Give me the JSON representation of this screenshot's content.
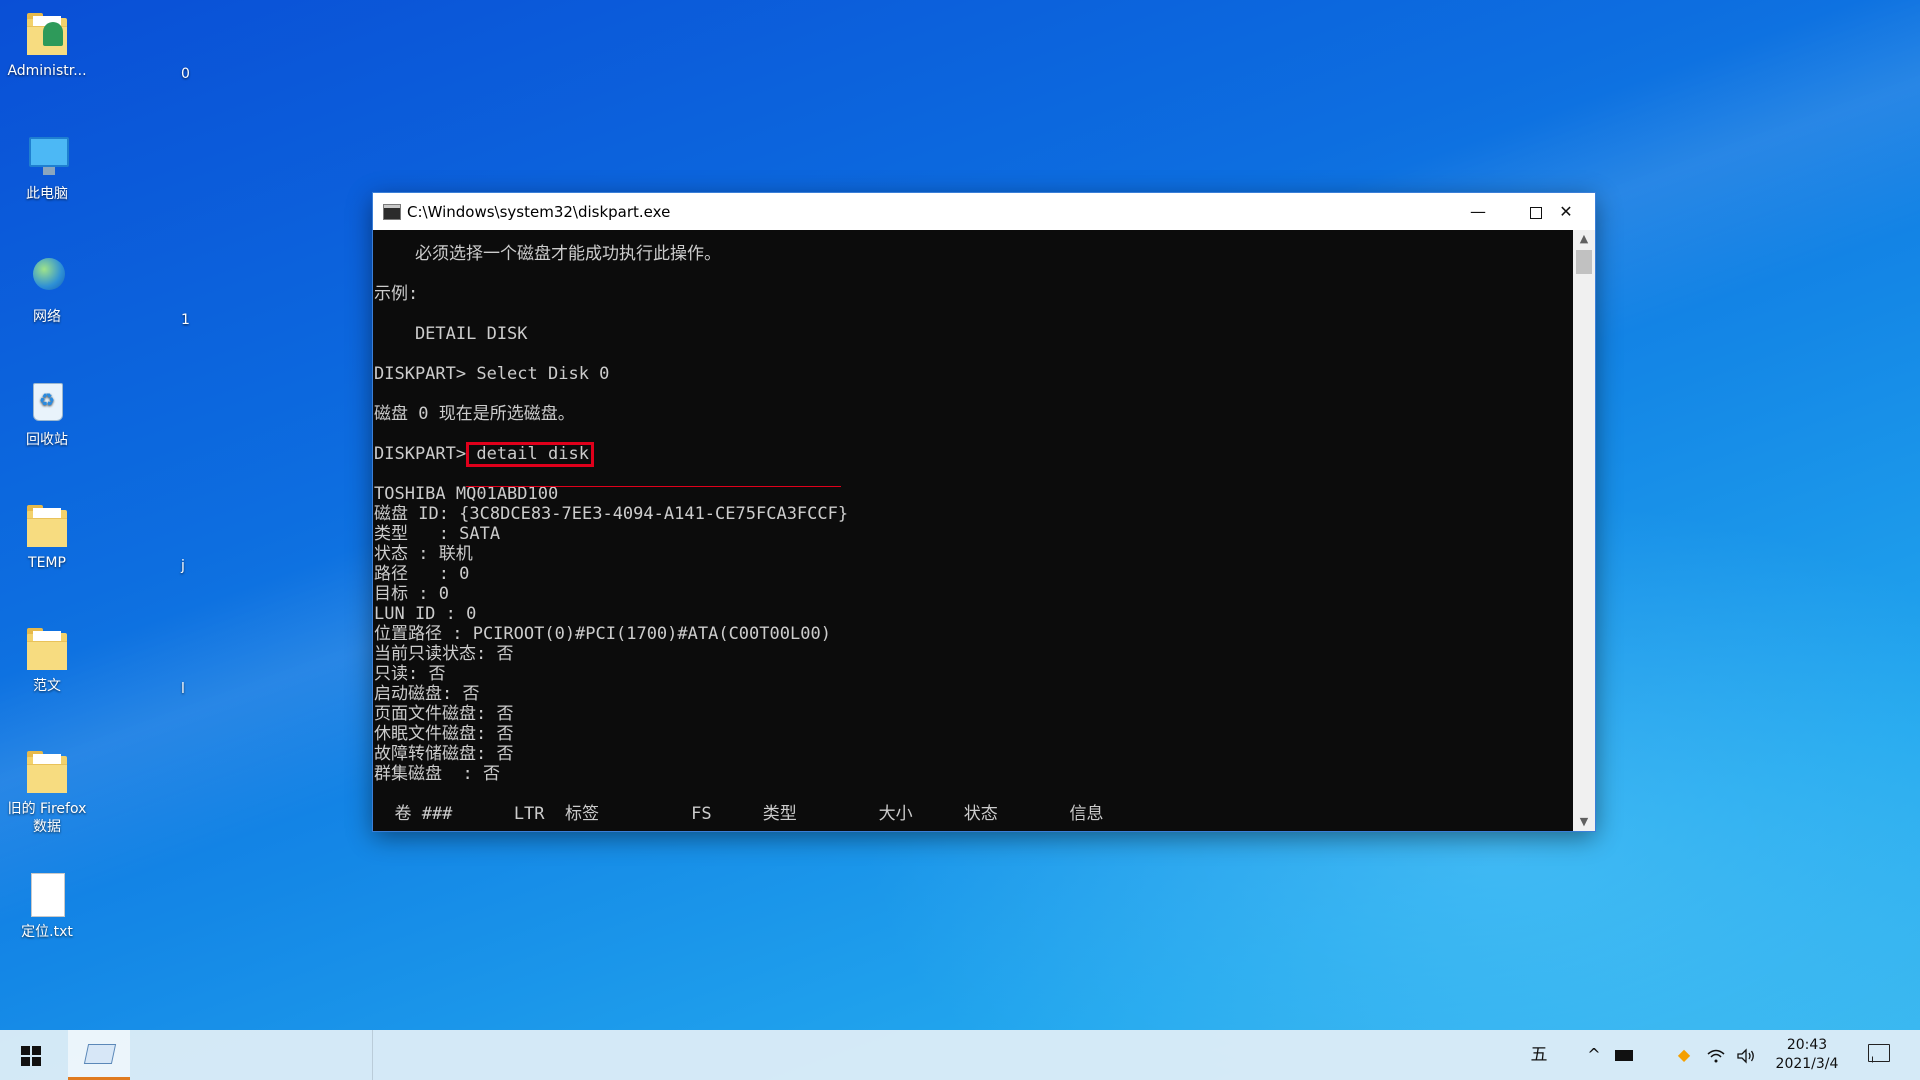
{
  "desktop": {
    "icons": [
      {
        "label": "Administr...",
        "icon": "user-folder-icon"
      },
      {
        "label": "此电脑",
        "icon": "computer-icon"
      },
      {
        "label": "网络",
        "icon": "network-icon"
      },
      {
        "label": "回收站",
        "icon": "recycle-bin-icon"
      },
      {
        "label": "TEMP",
        "icon": "folder-icon"
      },
      {
        "label": "范文",
        "icon": "folder-icon"
      },
      {
        "label": "旧的 Firefox\n数据",
        "icon": "folder-icon"
      },
      {
        "label": "定位.txt",
        "icon": "text-file-icon"
      }
    ],
    "partial_labels": [
      "0",
      "1",
      "l",
      "j"
    ]
  },
  "window": {
    "title": "C:\\Windows\\system32\\diskpart.exe",
    "minimize": "—",
    "close": "✕"
  },
  "console": {
    "lines": [
      "    必须选择一个磁盘才能成功执行此操作。",
      "",
      "示例:",
      "",
      "    DETAIL DISK",
      "",
      "DISKPART> Select Disk 0",
      "",
      "磁盘 0 现在是所选磁盘。",
      "",
      "DISKPART> detail disk",
      "",
      "TOSHIBA MQ01ABD100",
      "磁盘 ID: {3C8DCE83-7EE3-4094-A141-CE75FCA3FCCF}",
      "类型   : SATA",
      "状态 : 联机",
      "路径   : 0",
      "目标 : 0",
      "LUN ID : 0",
      "位置路径 : PCIROOT(0)#PCI(1700)#ATA(C00T00L00)",
      "当前只读状态: 否",
      "只读: 否",
      "启动磁盘: 否",
      "页面文件磁盘: 否",
      "休眠文件磁盘: 否",
      "故障转储磁盘: 否",
      "群集磁盘  : 否",
      "",
      "  卷 ###      LTR  标签         FS     类型        大小     状态       信息"
    ]
  },
  "taskbar": {
    "ime": "五",
    "tray_chevron": "^",
    "clock_time": "20:43",
    "clock_date": "2021/3/4"
  },
  "colors": {
    "console_bg": "#0c0c0c",
    "console_text": "#cccccc",
    "highlight": "#e0001b"
  }
}
